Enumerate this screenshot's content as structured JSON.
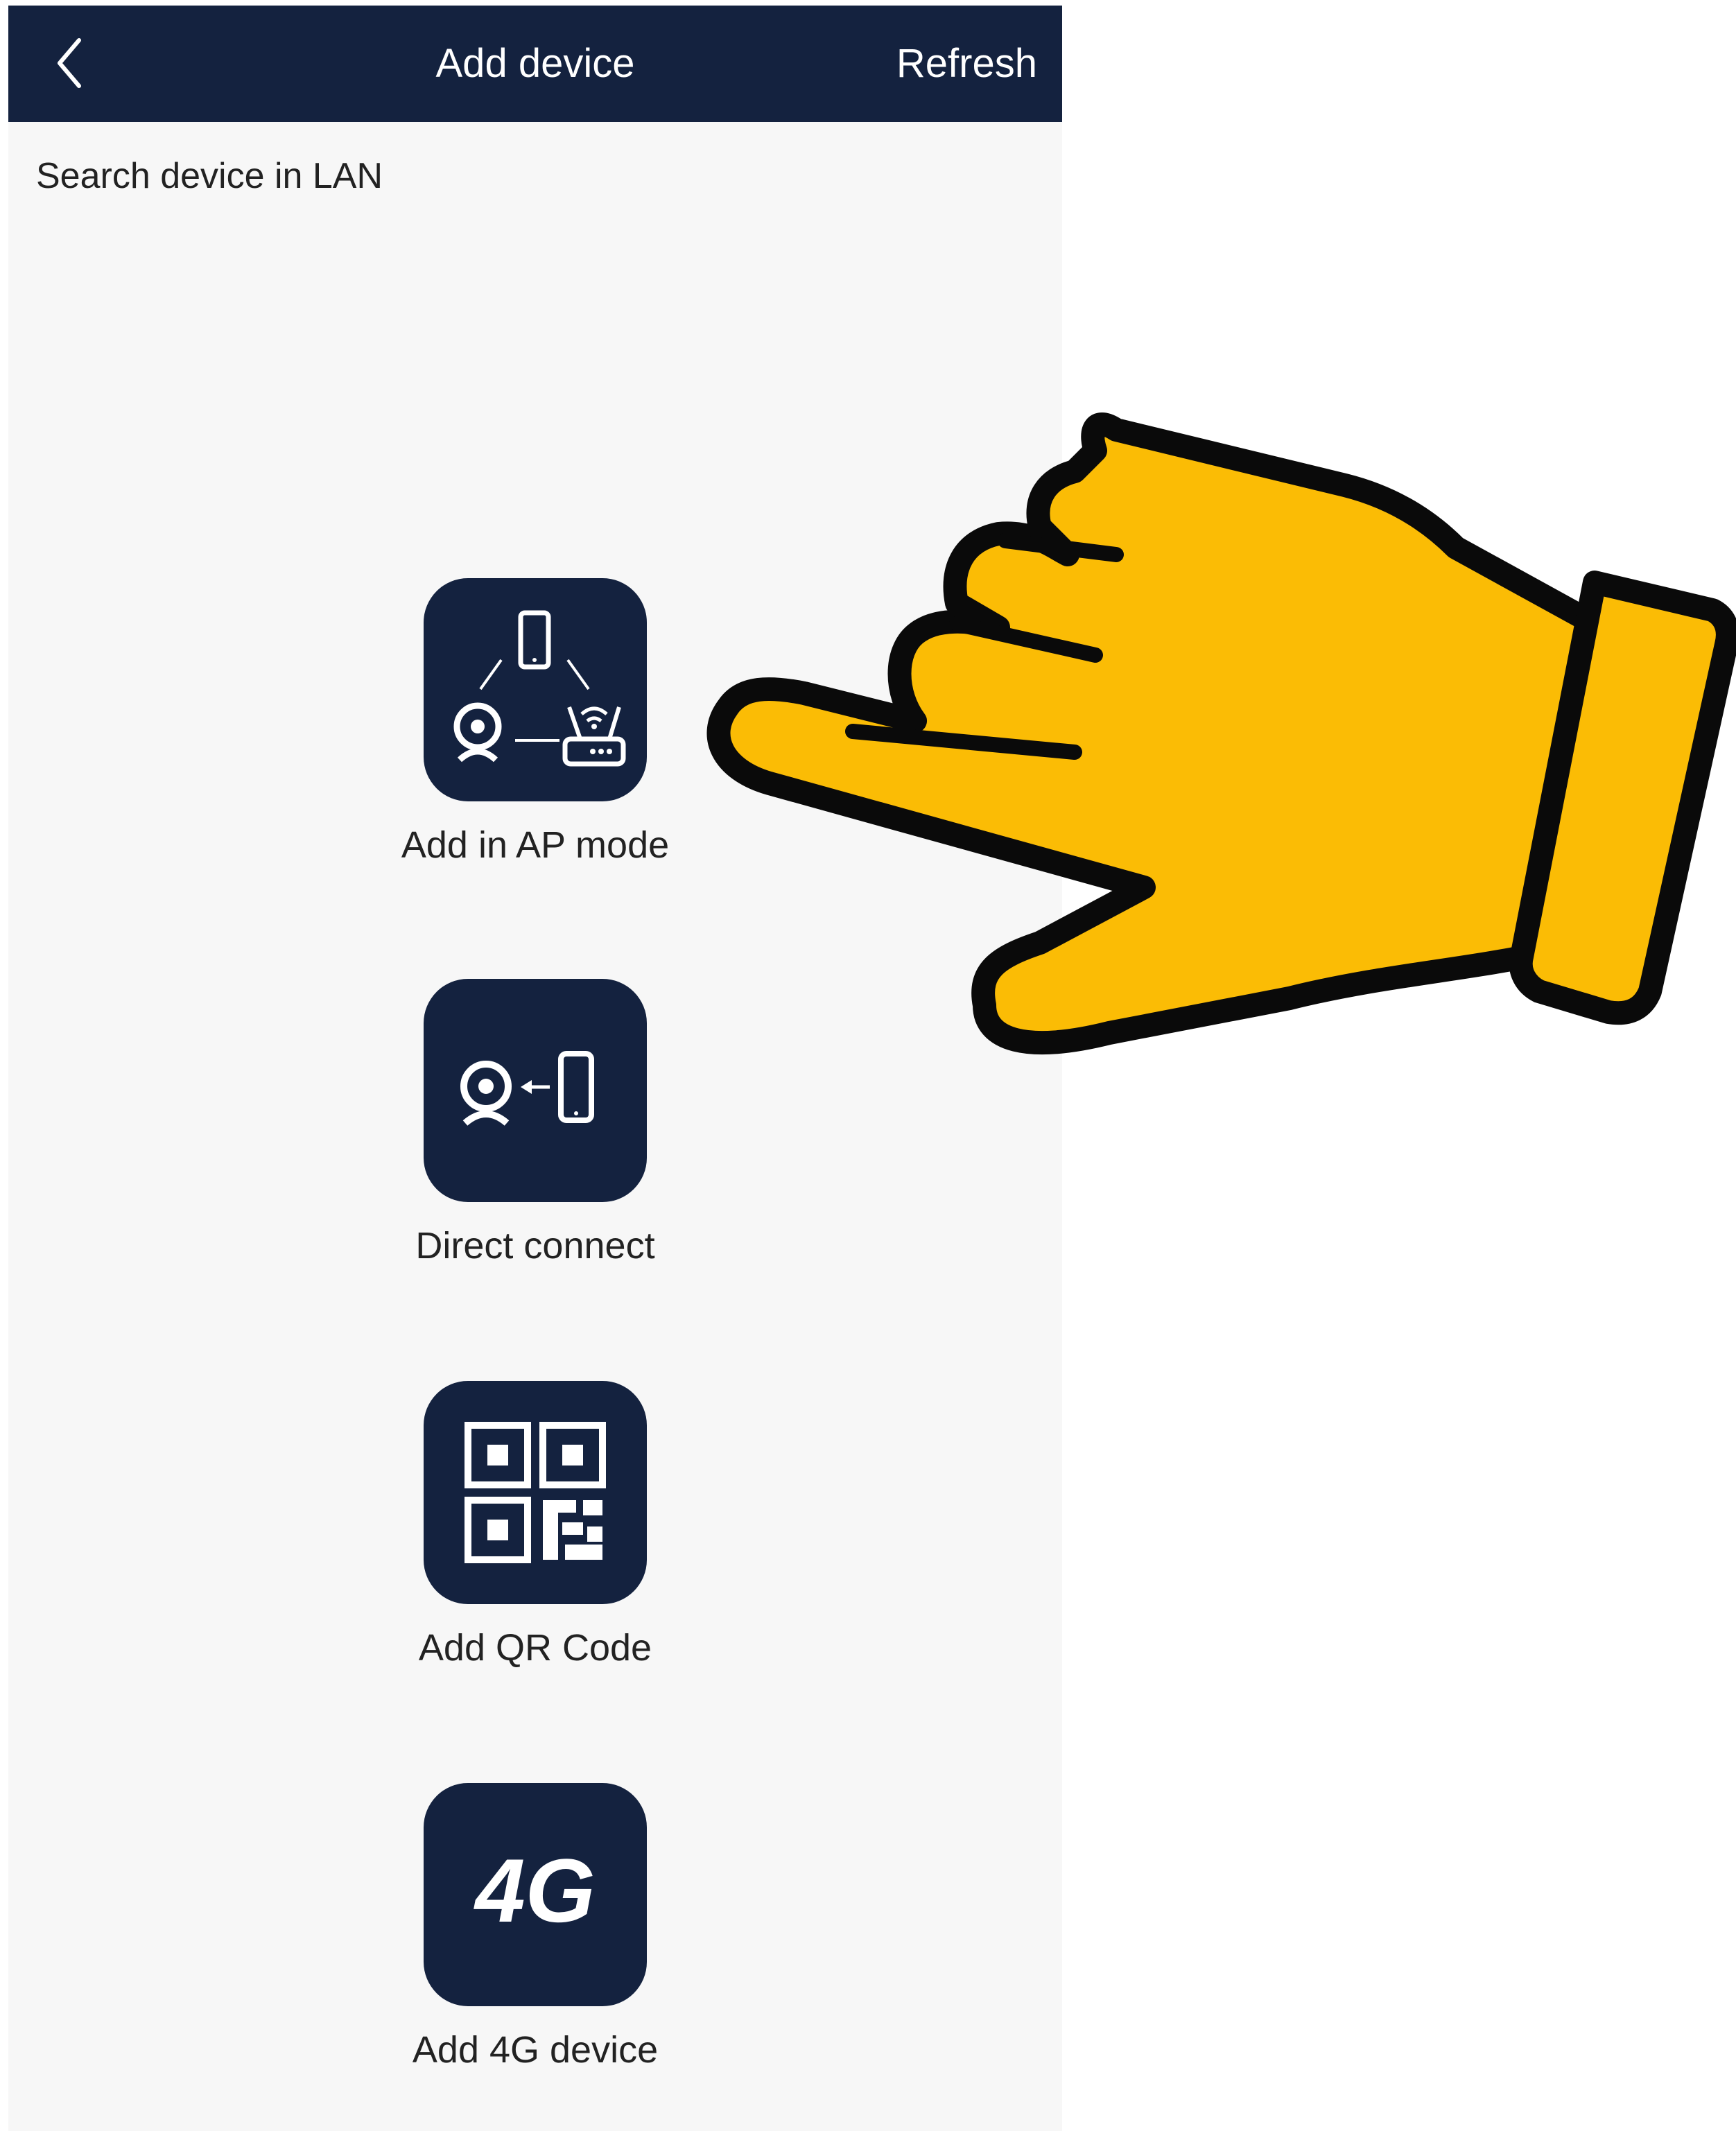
{
  "header": {
    "title": "Add device",
    "refresh_label": "Refresh",
    "back_icon": "chevron-left-icon",
    "background_color": "#14223f"
  },
  "section_label": "Search device in LAN",
  "options": [
    {
      "label": "Add in AP mode",
      "icon": "ap-mode-icon"
    },
    {
      "label": "Direct connect",
      "icon": "direct-connect-icon"
    },
    {
      "label": "Add QR Code",
      "icon": "qr-code-icon"
    },
    {
      "label": "Add 4G device",
      "icon": "4g-icon",
      "icon_text": "4G"
    }
  ],
  "overlay": {
    "icon": "pointing-hand-icon",
    "color": "#fbbc05"
  }
}
